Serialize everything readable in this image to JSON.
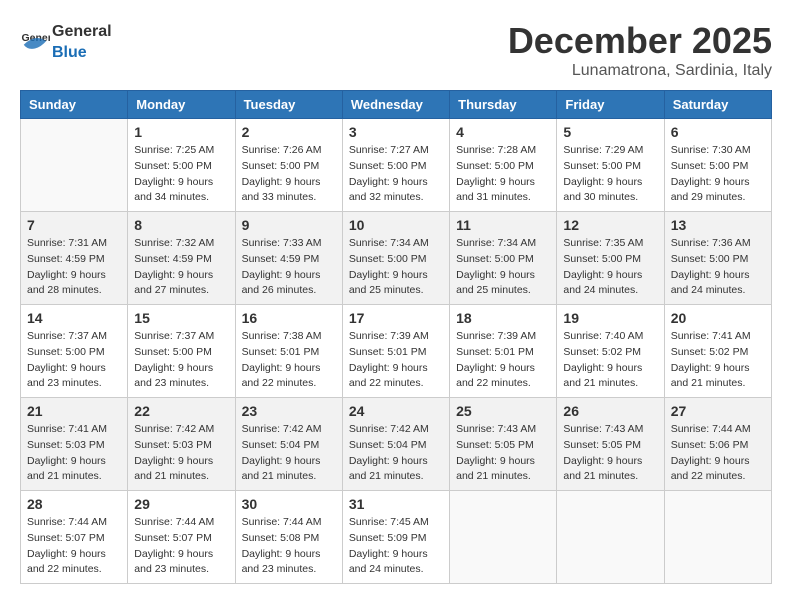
{
  "header": {
    "logo_general": "General",
    "logo_blue": "Blue",
    "month": "December 2025",
    "location": "Lunamatrona, Sardinia, Italy"
  },
  "weekdays": [
    "Sunday",
    "Monday",
    "Tuesday",
    "Wednesday",
    "Thursday",
    "Friday",
    "Saturday"
  ],
  "weeks": [
    [
      {
        "day": "",
        "info": ""
      },
      {
        "day": "1",
        "info": "Sunrise: 7:25 AM\nSunset: 5:00 PM\nDaylight: 9 hours\nand 34 minutes."
      },
      {
        "day": "2",
        "info": "Sunrise: 7:26 AM\nSunset: 5:00 PM\nDaylight: 9 hours\nand 33 minutes."
      },
      {
        "day": "3",
        "info": "Sunrise: 7:27 AM\nSunset: 5:00 PM\nDaylight: 9 hours\nand 32 minutes."
      },
      {
        "day": "4",
        "info": "Sunrise: 7:28 AM\nSunset: 5:00 PM\nDaylight: 9 hours\nand 31 minutes."
      },
      {
        "day": "5",
        "info": "Sunrise: 7:29 AM\nSunset: 5:00 PM\nDaylight: 9 hours\nand 30 minutes."
      },
      {
        "day": "6",
        "info": "Sunrise: 7:30 AM\nSunset: 5:00 PM\nDaylight: 9 hours\nand 29 minutes."
      }
    ],
    [
      {
        "day": "7",
        "info": "Sunrise: 7:31 AM\nSunset: 4:59 PM\nDaylight: 9 hours\nand 28 minutes."
      },
      {
        "day": "8",
        "info": "Sunrise: 7:32 AM\nSunset: 4:59 PM\nDaylight: 9 hours\nand 27 minutes."
      },
      {
        "day": "9",
        "info": "Sunrise: 7:33 AM\nSunset: 4:59 PM\nDaylight: 9 hours\nand 26 minutes."
      },
      {
        "day": "10",
        "info": "Sunrise: 7:34 AM\nSunset: 5:00 PM\nDaylight: 9 hours\nand 25 minutes."
      },
      {
        "day": "11",
        "info": "Sunrise: 7:34 AM\nSunset: 5:00 PM\nDaylight: 9 hours\nand 25 minutes."
      },
      {
        "day": "12",
        "info": "Sunrise: 7:35 AM\nSunset: 5:00 PM\nDaylight: 9 hours\nand 24 minutes."
      },
      {
        "day": "13",
        "info": "Sunrise: 7:36 AM\nSunset: 5:00 PM\nDaylight: 9 hours\nand 24 minutes."
      }
    ],
    [
      {
        "day": "14",
        "info": "Sunrise: 7:37 AM\nSunset: 5:00 PM\nDaylight: 9 hours\nand 23 minutes."
      },
      {
        "day": "15",
        "info": "Sunrise: 7:37 AM\nSunset: 5:00 PM\nDaylight: 9 hours\nand 23 minutes."
      },
      {
        "day": "16",
        "info": "Sunrise: 7:38 AM\nSunset: 5:01 PM\nDaylight: 9 hours\nand 22 minutes."
      },
      {
        "day": "17",
        "info": "Sunrise: 7:39 AM\nSunset: 5:01 PM\nDaylight: 9 hours\nand 22 minutes."
      },
      {
        "day": "18",
        "info": "Sunrise: 7:39 AM\nSunset: 5:01 PM\nDaylight: 9 hours\nand 22 minutes."
      },
      {
        "day": "19",
        "info": "Sunrise: 7:40 AM\nSunset: 5:02 PM\nDaylight: 9 hours\nand 21 minutes."
      },
      {
        "day": "20",
        "info": "Sunrise: 7:41 AM\nSunset: 5:02 PM\nDaylight: 9 hours\nand 21 minutes."
      }
    ],
    [
      {
        "day": "21",
        "info": "Sunrise: 7:41 AM\nSunset: 5:03 PM\nDaylight: 9 hours\nand 21 minutes."
      },
      {
        "day": "22",
        "info": "Sunrise: 7:42 AM\nSunset: 5:03 PM\nDaylight: 9 hours\nand 21 minutes."
      },
      {
        "day": "23",
        "info": "Sunrise: 7:42 AM\nSunset: 5:04 PM\nDaylight: 9 hours\nand 21 minutes."
      },
      {
        "day": "24",
        "info": "Sunrise: 7:42 AM\nSunset: 5:04 PM\nDaylight: 9 hours\nand 21 minutes."
      },
      {
        "day": "25",
        "info": "Sunrise: 7:43 AM\nSunset: 5:05 PM\nDaylight: 9 hours\nand 21 minutes."
      },
      {
        "day": "26",
        "info": "Sunrise: 7:43 AM\nSunset: 5:05 PM\nDaylight: 9 hours\nand 21 minutes."
      },
      {
        "day": "27",
        "info": "Sunrise: 7:44 AM\nSunset: 5:06 PM\nDaylight: 9 hours\nand 22 minutes."
      }
    ],
    [
      {
        "day": "28",
        "info": "Sunrise: 7:44 AM\nSunset: 5:07 PM\nDaylight: 9 hours\nand 22 minutes."
      },
      {
        "day": "29",
        "info": "Sunrise: 7:44 AM\nSunset: 5:07 PM\nDaylight: 9 hours\nand 23 minutes."
      },
      {
        "day": "30",
        "info": "Sunrise: 7:44 AM\nSunset: 5:08 PM\nDaylight: 9 hours\nand 23 minutes."
      },
      {
        "day": "31",
        "info": "Sunrise: 7:45 AM\nSunset: 5:09 PM\nDaylight: 9 hours\nand 24 minutes."
      },
      {
        "day": "",
        "info": ""
      },
      {
        "day": "",
        "info": ""
      },
      {
        "day": "",
        "info": ""
      }
    ]
  ]
}
